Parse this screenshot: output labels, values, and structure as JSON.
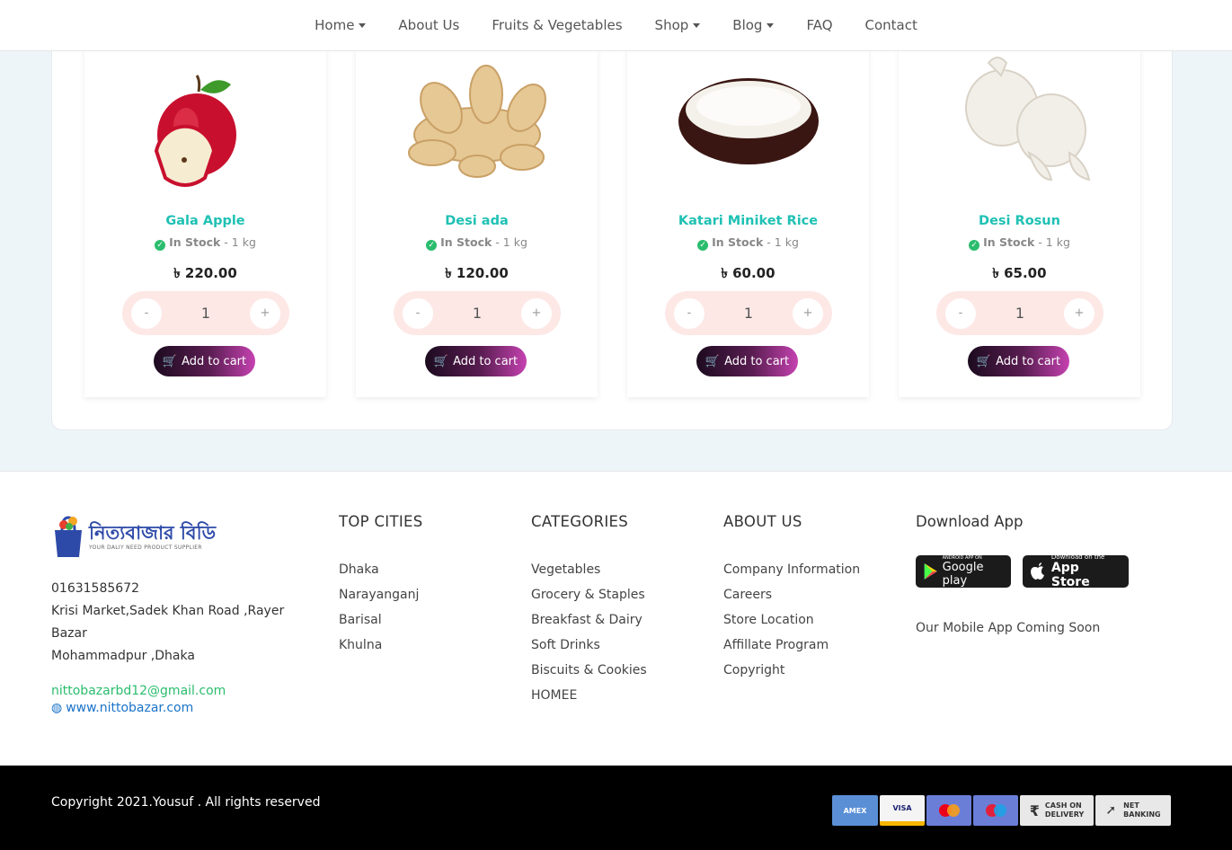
{
  "nav": {
    "items": [
      {
        "label": "Home",
        "dropdown": true
      },
      {
        "label": "About Us",
        "dropdown": false
      },
      {
        "label": "Fruits & Vegetables",
        "dropdown": false
      },
      {
        "label": "Shop",
        "dropdown": true
      },
      {
        "label": "Blog",
        "dropdown": true
      },
      {
        "label": "FAQ",
        "dropdown": false
      },
      {
        "label": "Contact",
        "dropdown": false
      }
    ]
  },
  "products": [
    {
      "name": "Gala Apple",
      "stock": "In Stock",
      "unit": "- 1 kg",
      "price": "৳ 220.00",
      "qty": "1",
      "minus": "-",
      "plus": "+",
      "cart": "Add to cart",
      "image": "apple"
    },
    {
      "name": "Desi ada",
      "stock": "In Stock",
      "unit": "- 1 kg",
      "price": "৳ 120.00",
      "qty": "1",
      "minus": "-",
      "plus": "+",
      "cart": "Add to cart",
      "image": "ginger"
    },
    {
      "name": "Katari Miniket Rice",
      "stock": "In Stock",
      "unit": "- 1 kg",
      "price": "৳ 60.00",
      "qty": "1",
      "minus": "-",
      "plus": "+",
      "cart": "Add to cart",
      "image": "rice"
    },
    {
      "name": "Desi Rosun",
      "stock": "In Stock",
      "unit": "- 1 kg",
      "price": "৳ 65.00",
      "qty": "1",
      "minus": "-",
      "plus": "+",
      "cart": "Add to cart",
      "image": "garlic"
    }
  ],
  "footer": {
    "logo_text": "নিত্যবাজার বিডি",
    "logo_tagline": "YOUR DALIY NEED PRODUCT SUPPLIER",
    "phone": "01631585672",
    "address_line1": "Krisi Market,Sadek Khan Road ,Rayer",
    "address_line2": "Bazar",
    "address_line3": "Mohammadpur ,Dhaka",
    "email": "nittobazarbd12@gmail.com",
    "website": "www.nittobazar.com",
    "top_cities": {
      "title": "TOP CITIES",
      "items": [
        "Dhaka",
        "Narayanganj",
        "Barisal",
        "Khulna"
      ]
    },
    "categories": {
      "title": "CATEGORIES",
      "items": [
        "Vegetables",
        "Grocery & Staples",
        "Breakfast & Dairy",
        "Soft Drinks",
        "Biscuits & Cookies",
        "HOMEE"
      ]
    },
    "about": {
      "title": "ABOUT US",
      "items": [
        "Company Information",
        "Careers",
        "Store Location",
        "Affillate Program",
        "Copyright"
      ]
    },
    "app": {
      "title": "Download App",
      "google_small": "ANDROID APP ON",
      "google_big": "Google play",
      "apple_small": "Download on the",
      "apple_big": "App Store",
      "note": "Our Mobile App Coming Soon"
    }
  },
  "bottom": {
    "copyright": "Copyright 2021.Yousuf . All rights reserved",
    "payments": {
      "amex": "AMEX",
      "visa": "VISA",
      "cod_line1": "CASH ON",
      "cod_line2": "DELIVERY",
      "nb_line1": "NET",
      "nb_line2": "BANKING"
    }
  },
  "colors": {
    "accent": "#1fc1b4",
    "stock_check": "#2bbd6e",
    "link_blue": "#1a73c8",
    "cart_gradient_end": "#c542b0"
  }
}
